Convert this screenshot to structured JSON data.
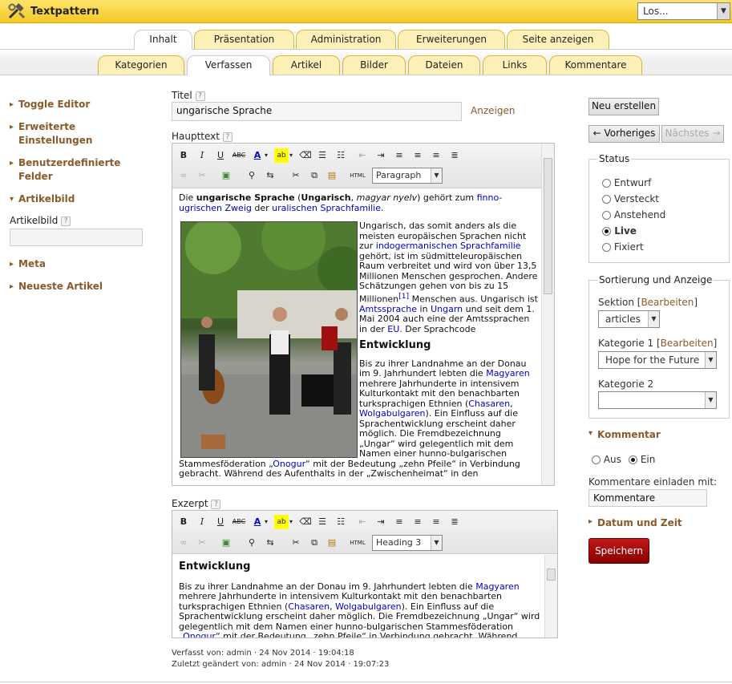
{
  "app": {
    "title": "Textpattern",
    "go_select": "Los..."
  },
  "tabs_primary": [
    {
      "label": "Inhalt"
    },
    {
      "label": "Präsentation"
    },
    {
      "label": "Administration"
    },
    {
      "label": "Erweiterungen"
    },
    {
      "label": "Seite anzeigen"
    }
  ],
  "tabs_secondary": [
    {
      "label": "Kategorien"
    },
    {
      "label": "Verfassen"
    },
    {
      "label": "Artikel"
    },
    {
      "label": "Bilder"
    },
    {
      "label": "Dateien"
    },
    {
      "label": "Links"
    },
    {
      "label": "Kommentare"
    }
  ],
  "sidebar": {
    "toggle_editor": "Toggle Editor",
    "advanced": "Erweiterte Einstellungen",
    "custom_fields": "Benutzerdefinierte Felder",
    "article_image": "Artikelbild",
    "article_image_label": "Artikelbild",
    "meta": "Meta",
    "recent": "Neueste Artikel",
    "help_mark": "?"
  },
  "main": {
    "title_label": "Titel",
    "title_value": "ungarische Sprache",
    "view_link": "Anzeigen",
    "body_label": "Haupttext",
    "excerpt_label": "Exzerpt",
    "format_body": "Paragraph",
    "format_excerpt": "Heading 3",
    "html_button": "HTML",
    "body_p1": {
      "t1": "Die ",
      "b1": "ungarische Sprache",
      "t2": " (",
      "b2": "Ungarisch",
      "t3": ", ",
      "i1": "magyar nyelv",
      "t4": ") gehört zum ",
      "l1": "finno-ugrischen Zweig",
      "t5": " der ",
      "l2": "uralischen Sprachfamilie",
      "t6": "."
    },
    "body_p2": {
      "t1": "Ungarisch, das somit anders als die meisten europäischen Sprachen nicht zur ",
      "l1": "indogermanischen Sprachfamilie",
      "t2": " gehört, ist im südmitteleuropäischen Raum verbreitet und wird von über 13,5 Millionen Menschen gesprochen. Andere Schätzungen gehen von bis zu 15 Millionen",
      "sup": "[1]",
      "t3": " Menschen aus. Ungarisch ist ",
      "l2": "Amtssprache",
      "t4": " in ",
      "l3": "Ungarn",
      "t5": " und seit dem 1. Mai 2004 auch eine der Amtssprachen in der ",
      "l4": "EU",
      "t6": ". Der Sprachcode"
    },
    "body_h": "Entwicklung",
    "body_p3": {
      "t1": "Bis zu ihrer Landnahme an der Donau im 9. Jahrhundert lebten die ",
      "l1": "Magyaren",
      "t2": " mehrere Jahrhunderte in intensivem Kulturkontakt mit den benachbarten turksprachigen Ethnien (",
      "l2": "Chasaren",
      "t3": ", ",
      "l3": "Wolgabulgaren",
      "t4": "). Ein Einfluss auf die Sprachentwicklung erscheint daher möglich. Die Fremdbezeichnung „Ungar“ wird gelegentlich mit dem Namen einer hunno-bulgarischen Stammesföderation „",
      "l4": "Onogur",
      "t5": "“ mit der Bedeutung „zehn Pfeile“ in Verbindung gebracht. Während des Aufenthalts in der „Zwischenheimat“ in den"
    },
    "excerpt_h": "Entwicklung",
    "excerpt_p": {
      "t1": "Bis zu ihrer Landnahme an der Donau im 9. Jahrhundert lebten die ",
      "l1": "Magyaren",
      "t2": " mehrere Jahrhunderte in intensivem Kulturkontakt mit den benachbarten turksprachigen Ethnien (",
      "l2": "Chasaren",
      "t3": ", ",
      "l3": "Wolgabulgaren",
      "t4": "). Ein Einfluss auf die Sprachentwicklung erscheint daher möglich. Die Fremdbezeichnung „Ungar“ wird gelegentlich mit dem Namen einer hunno-bulgarischen Stammesföderation „",
      "l4": "Onogur",
      "t5": "“ mit der Bedeutung „zehn Pfeile“ in Verbindung gebracht. Während"
    },
    "posted": "Verfasst von: admin · 24 Nov 2014 · 19:04:18",
    "modified": "Zuletzt geändert von: admin · 24 Nov 2014 · 19:07:23"
  },
  "right": {
    "new": "Neu erstellen",
    "prev": "← Vorheriges",
    "next": "Nächstes →",
    "status_legend": "Status",
    "status": [
      {
        "label": "Entwurf"
      },
      {
        "label": "Versteckt"
      },
      {
        "label": "Anstehend"
      },
      {
        "label": "Live"
      },
      {
        "label": "Fixiert"
      }
    ],
    "sort_legend": "Sortierung und Anzeige",
    "section_label": "Sektion [",
    "edit": "Bearbeiten",
    "close_bracket": "]",
    "section_value": "articles",
    "cat1_label": "Kategorie 1 [",
    "cat1_value": "Hope for the Future",
    "cat2_label": "Kategorie 2",
    "comments": "Kommentar",
    "off": "Aus",
    "on": "Ein",
    "invite_label": "Kommentare einladen mit:",
    "invite_value": "Kommentare",
    "date": "Datum und Zeit",
    "save": "Speichern"
  },
  "colors": {
    "brand": "#f5c824",
    "accent": "#8a5a2a",
    "save": "#a00000",
    "tab_inactive": "#fdf1b8"
  }
}
